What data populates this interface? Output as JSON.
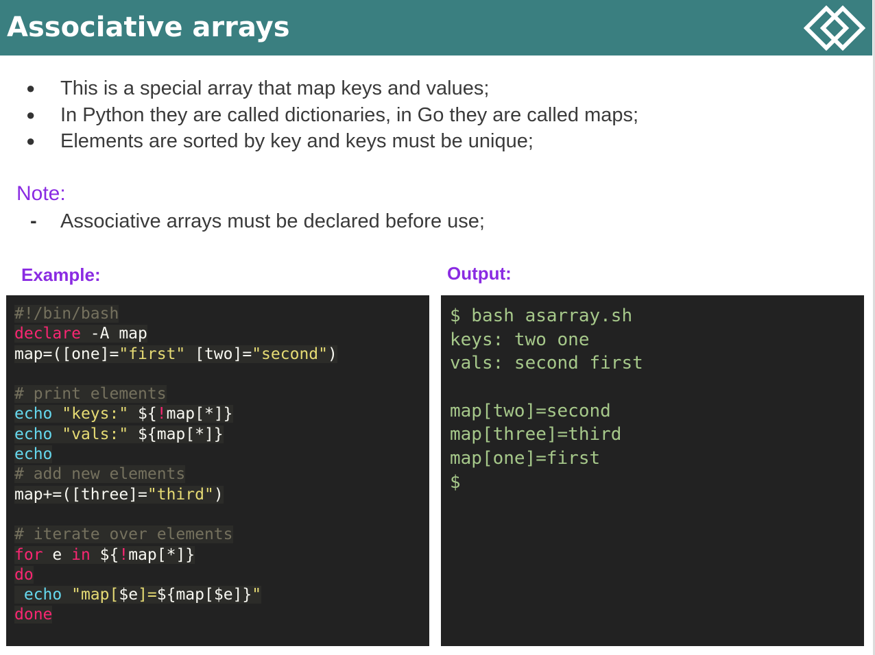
{
  "slide": {
    "title": "Associative arrays",
    "brand_color": "#3a7f80",
    "accent_color": "#8a2be2",
    "logo_icon": "diamond-logo-icon"
  },
  "bullets": [
    "This is a special array that map keys and values;",
    "In Python they are called dictionaries, in Go they are called maps;",
    "Elements are sorted by key and keys must be unique;"
  ],
  "note": {
    "heading": "Note:",
    "items": [
      "Associative arrays must be declared before use;"
    ]
  },
  "example_label": "Example:",
  "output_label": "Output:",
  "code_lines": [
    {
      "parts": [
        {
          "t": "#!/bin/bash",
          "c": "cm"
        }
      ]
    },
    {
      "parts": [
        {
          "t": "declare",
          "c": "kw"
        },
        {
          "t": " -A map",
          "c": ""
        }
      ]
    },
    {
      "parts": [
        {
          "t": "map=([one]=",
          "c": ""
        },
        {
          "t": "\"first\"",
          "c": "st"
        },
        {
          "t": " [two]=",
          "c": ""
        },
        {
          "t": "\"second\"",
          "c": "st"
        },
        {
          "t": ")",
          "c": ""
        }
      ]
    },
    {
      "parts": []
    },
    {
      "parts": [
        {
          "t": "# print elements",
          "c": "cm"
        }
      ]
    },
    {
      "parts": [
        {
          "t": "echo",
          "c": "bl"
        },
        {
          "t": " ",
          "c": ""
        },
        {
          "t": "\"keys:\"",
          "c": "st"
        },
        {
          "t": " ${",
          "c": ""
        },
        {
          "t": "!",
          "c": "kw"
        },
        {
          "t": "map[*]}",
          "c": ""
        }
      ]
    },
    {
      "parts": [
        {
          "t": "echo",
          "c": "bl"
        },
        {
          "t": " ",
          "c": ""
        },
        {
          "t": "\"vals:\"",
          "c": "st"
        },
        {
          "t": " ${map[*]}",
          "c": ""
        }
      ]
    },
    {
      "parts": [
        {
          "t": "echo",
          "c": "bl"
        }
      ]
    },
    {
      "parts": [
        {
          "t": "# add new elements",
          "c": "cm"
        }
      ]
    },
    {
      "parts": [
        {
          "t": "map+=([three]=",
          "c": ""
        },
        {
          "t": "\"third\"",
          "c": "st"
        },
        {
          "t": ")",
          "c": ""
        }
      ]
    },
    {
      "parts": []
    },
    {
      "parts": [
        {
          "t": "# iterate over elements",
          "c": "cm"
        }
      ]
    },
    {
      "parts": [
        {
          "t": "for",
          "c": "kw"
        },
        {
          "t": " e ",
          "c": ""
        },
        {
          "t": "in",
          "c": "kw"
        },
        {
          "t": " ${",
          "c": ""
        },
        {
          "t": "!",
          "c": "kw"
        },
        {
          "t": "map[*]}",
          "c": ""
        }
      ]
    },
    {
      "parts": [
        {
          "t": "do",
          "c": "kw"
        }
      ]
    },
    {
      "parts": [
        {
          "t": " ",
          "c": ""
        },
        {
          "t": "echo",
          "c": "bl"
        },
        {
          "t": " ",
          "c": ""
        },
        {
          "t": "\"map[",
          "c": "st"
        },
        {
          "t": "$e",
          "c": ""
        },
        {
          "t": "]=",
          "c": "st"
        },
        {
          "t": "${map[$e]}",
          "c": ""
        },
        {
          "t": "\"",
          "c": "st"
        }
      ]
    },
    {
      "parts": [
        {
          "t": "done",
          "c": "kw"
        }
      ]
    }
  ],
  "output_lines": [
    "$ bash asarray.sh",
    "keys: two one",
    "vals: second first",
    "",
    "map[two]=second",
    "map[three]=third",
    "map[one]=first",
    "$"
  ]
}
